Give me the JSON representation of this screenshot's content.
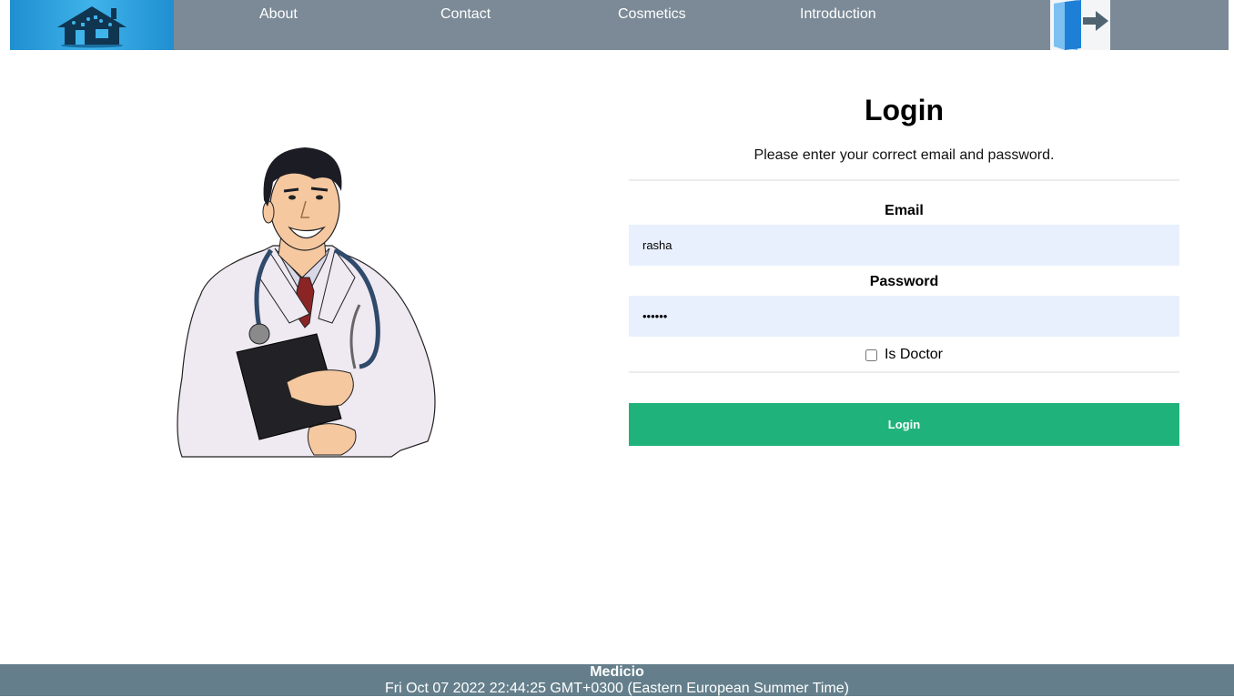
{
  "nav": {
    "logo_icon": "house-logo-icon",
    "links": [
      {
        "label": "About"
      },
      {
        "label": "Contact"
      },
      {
        "label": "Cosmetics"
      },
      {
        "label": "Introduction"
      }
    ],
    "exit_icon": "logout-door-icon"
  },
  "illustration": {
    "icon": "doctor-illustration"
  },
  "login": {
    "title": "Login",
    "subtitle": "Please enter your correct email and password.",
    "email_label": "Email",
    "email_value": "rasha",
    "password_label": "Password",
    "password_value": "••••••",
    "is_doctor_label": "Is Doctor",
    "submit_label": "Login"
  },
  "footer": {
    "brand": "Medicio",
    "datetime": "Fri Oct 07 2022 22:44:25 GMT+0300 (Eastern European Summer Time)"
  },
  "colors": {
    "navbar": "#7b8a96",
    "footer": "#647f8b",
    "login_button": "#1fb37b",
    "input_background": "#e8f0fe",
    "logo_blue": "#3fb3ea"
  }
}
